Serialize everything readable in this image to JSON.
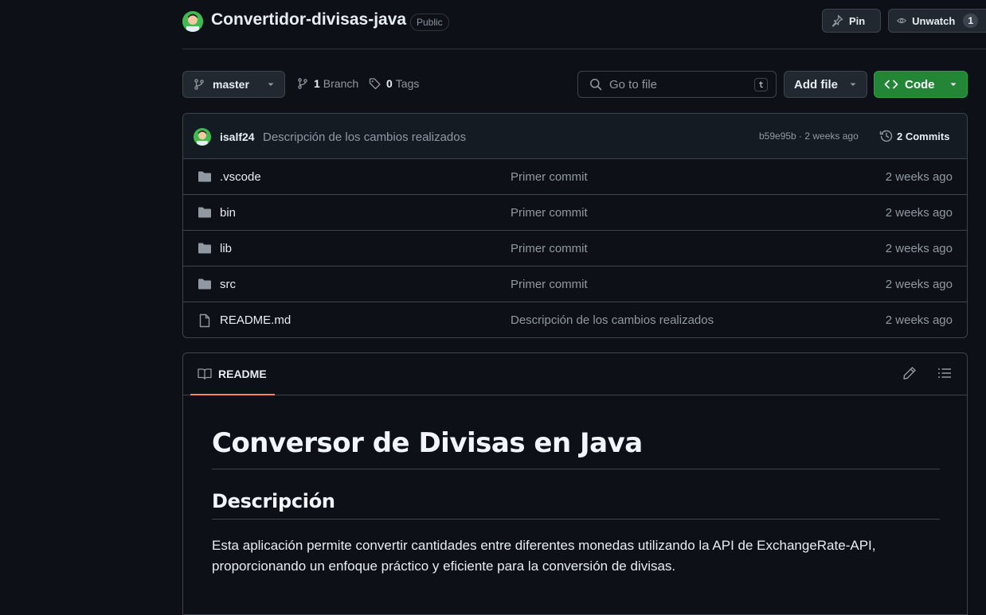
{
  "repo": {
    "name": "Convertidor-divisas-java",
    "visibility": "Public",
    "pin_label": "Pin",
    "unwatch_label": "Unwatch",
    "watch_count": "1"
  },
  "toolbar": {
    "branch": "master",
    "branch_count": "1",
    "branch_label": "Branch",
    "tag_count": "0",
    "tag_label": "Tags",
    "search_placeholder": "Go to file",
    "search_shortcut": "t",
    "add_file_label": "Add file",
    "code_label": "Code"
  },
  "latest_commit": {
    "author": "isalf24",
    "message": "Descripción de los cambios realizados",
    "meta": "b59e95b · 2 weeks ago",
    "commits_label": "2 Commits"
  },
  "files": [
    {
      "name": ".vscode",
      "type": "folder",
      "message": "Primer commit",
      "date": "2 weeks ago"
    },
    {
      "name": "bin",
      "type": "folder",
      "message": "Primer commit",
      "date": "2 weeks ago"
    },
    {
      "name": "lib",
      "type": "folder",
      "message": "Primer commit",
      "date": "2 weeks ago"
    },
    {
      "name": "src",
      "type": "folder",
      "message": "Primer commit",
      "date": "2 weeks ago"
    },
    {
      "name": "README.md",
      "type": "file",
      "message": "Descripción de los cambios realizados",
      "date": "2 weeks ago"
    }
  ],
  "readme": {
    "tab_label": "README",
    "h1": "Conversor de Divisas en Java",
    "h2": "Descripción",
    "paragraph": "Esta aplicación permite convertir cantidades entre diferentes monedas utilizando la API de ExchangeRate-API, proporcionando un enfoque práctico y eficiente para la conversión de divisas."
  },
  "colors": {
    "background": "#0d1117",
    "border": "#3d444d",
    "primary_button": "#238636",
    "tab_underline": "#f78166"
  },
  "icons": [
    "avatar",
    "pin-icon",
    "eye-icon",
    "branch-icon",
    "tag-icon",
    "search-icon",
    "caret-down-icon",
    "code-icon",
    "history-icon",
    "folder-icon",
    "file-icon",
    "book-icon",
    "pencil-icon",
    "list-icon"
  ]
}
